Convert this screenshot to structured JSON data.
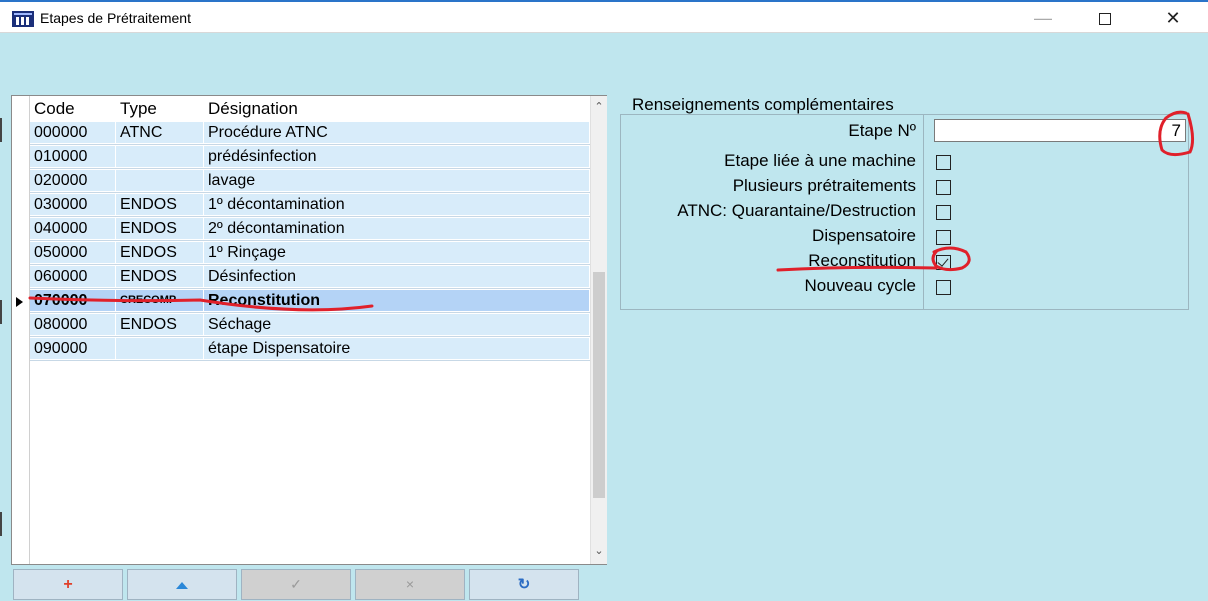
{
  "window": {
    "title": "Etapes de Prétraitement",
    "minimize": "—",
    "close": "✕"
  },
  "grid": {
    "columns": [
      "Code",
      "Type",
      "Désignation"
    ],
    "rows": [
      {
        "code": "000000",
        "type": "ATNC",
        "designation": "Procédure ATNC"
      },
      {
        "code": "010000",
        "type": "",
        "designation": "prédésinfection"
      },
      {
        "code": "020000",
        "type": "",
        "designation": "lavage"
      },
      {
        "code": "030000",
        "type": "ENDOS",
        "designation": " 1º décontamination"
      },
      {
        "code": "040000",
        "type": "ENDOS",
        "designation": " 2º décontamination"
      },
      {
        "code": "050000",
        "type": "ENDOS",
        "designation": " 1º Rinçage"
      },
      {
        "code": "060000",
        "type": "ENDOS",
        "designation": " Désinfection"
      },
      {
        "code": "070000",
        "type": "CRECOMP",
        "designation": "Reconstitution",
        "selected": true
      },
      {
        "code": "080000",
        "type": "ENDOS",
        "designation": " Séchage"
      },
      {
        "code": "090000",
        "type": "",
        "designation": "étape Dispensatoire"
      }
    ],
    "scroll_up": "⌃",
    "scroll_down": "⌄"
  },
  "toolbar": {
    "add": "+",
    "confirm": "✓",
    "cancel": "×",
    "refresh": "↻"
  },
  "details": {
    "title": "Renseignements complémentaires",
    "etape_label": "Etape Nº",
    "etape_value": "7",
    "fields": [
      {
        "label": "Etape liée à une machine",
        "checked": false
      },
      {
        "label": "Plusieurs prétraitements",
        "checked": false
      },
      {
        "label": "ATNC: Quarantaine/Destruction",
        "checked": false
      },
      {
        "label": "Dispensatoire",
        "checked": false
      },
      {
        "label": "Reconstitution",
        "checked": true
      },
      {
        "label": "Nouveau cycle",
        "checked": false
      }
    ]
  },
  "colors": {
    "background": "#bfe6ee",
    "row_alt": "#d8ecfa",
    "row_selected": "#b4d3f6",
    "annotation": "#e0202a"
  }
}
